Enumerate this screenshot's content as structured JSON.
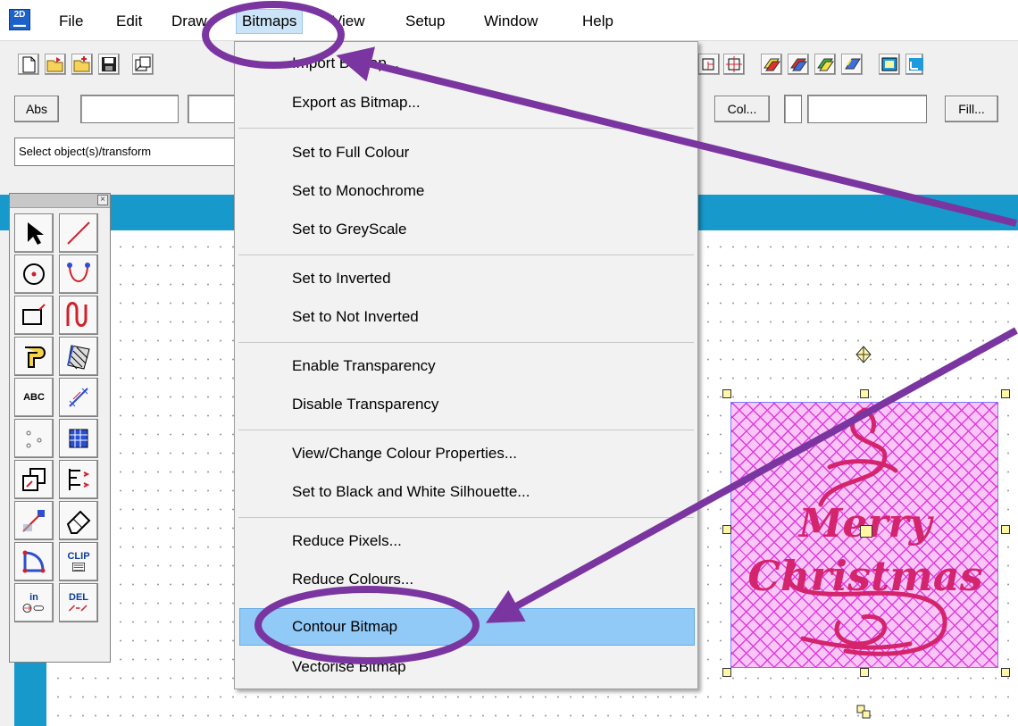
{
  "menubar": {
    "items": [
      {
        "id": "file",
        "label": "File"
      },
      {
        "id": "edit",
        "label": "Edit"
      },
      {
        "id": "draw",
        "label": "Draw"
      },
      {
        "id": "bitmaps",
        "label": "Bitmaps"
      },
      {
        "id": "view",
        "label": "View"
      },
      {
        "id": "setup",
        "label": "Setup"
      },
      {
        "id": "window",
        "label": "Window"
      },
      {
        "id": "help",
        "label": "Help"
      }
    ],
    "open_menu": "Bitmaps"
  },
  "bitmaps_menu": {
    "items": [
      "Import Bitmap...",
      "Export as Bitmap...",
      "Set to Full Colour",
      "Set to Monochrome",
      "Set to GreyScale",
      "Set to Inverted",
      "Set to Not Inverted",
      "Enable Transparency",
      "Disable Transparency",
      "View/Change Colour Properties...",
      "Set to Black and White Silhouette...",
      "Reduce Pixels...",
      "Reduce Colours...",
      "Contour Bitmap",
      "Vectorise Bitmap"
    ],
    "highlighted": "Contour Bitmap"
  },
  "toolbar2": {
    "abs_label": "Abs",
    "col_label": "Col...",
    "fill_label": "Fill..."
  },
  "status": {
    "text": "Select object(s)/transform"
  },
  "palette": {
    "text_tool_label": "ABC",
    "clip_label": "CLIP",
    "in_label": "in",
    "del_label": "DEL"
  },
  "bitmap": {
    "text_line1": "Merry",
    "text_line2": "Christmas"
  },
  "colors": {
    "annotation": "#7a35a0",
    "highlight": "#91c9f7",
    "blue_bar": "#1899cc",
    "bitmap_hatch": "#e03ae0",
    "bitmap_text": "#d4246e"
  }
}
